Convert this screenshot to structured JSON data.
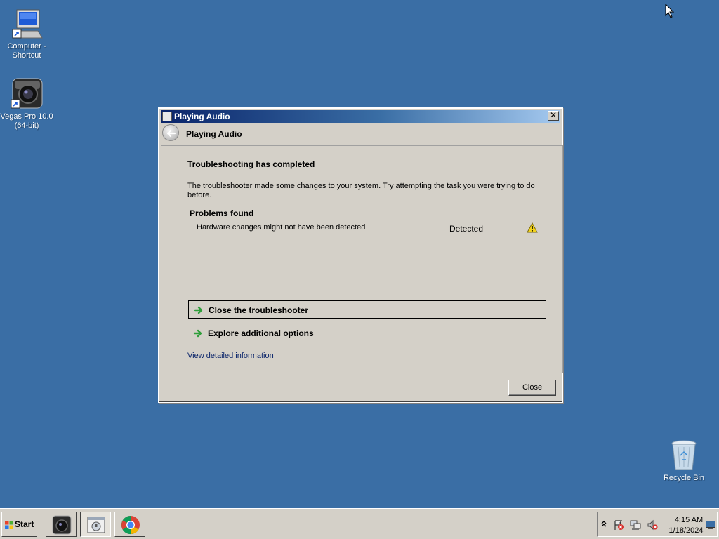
{
  "desktop": {
    "icons": [
      {
        "label_line1": "Computer -",
        "label_line2": "Shortcut",
        "icon": "computer-icon"
      },
      {
        "label_line1": "Vegas Pro 10.0",
        "label_line2": "(64-bit)",
        "icon": "vegas-pro-icon"
      },
      {
        "label_line1": "Recycle Bin",
        "icon": "recycle-bin-icon"
      }
    ]
  },
  "dialog": {
    "title": "Playing Audio",
    "nav_title": "Playing Audio",
    "heading": "Troubleshooting has completed",
    "description": "The troubleshooter made some changes to your system. Try attempting the task you were trying to do before.",
    "problems_title": "Problems found",
    "problems": [
      {
        "name": "Hardware changes might not have been detected",
        "status": "Detected",
        "icon": "warning-icon"
      }
    ],
    "options": [
      {
        "label": "Close the troubleshooter",
        "selected": true
      },
      {
        "label": "Explore additional options",
        "selected": false
      }
    ],
    "detail_link": "View detailed information",
    "close_button": "Close",
    "close_glyph": "✕"
  },
  "taskbar": {
    "start_label": "Start",
    "tasks": [
      "vegas-pro-icon",
      "troubleshooter-icon",
      "chrome-icon"
    ],
    "clock_time": "4:15 AM",
    "clock_date": "1/18/2024",
    "tray_icons": [
      "chevron-up-icon",
      "action-center-icon",
      "network-icon",
      "volume-muted-icon",
      "show-desktop-icon"
    ]
  },
  "colors": {
    "desktop": "#3a6ea5",
    "dialog_face": "#d4d0c8",
    "title_gradient_start": "#0a246a",
    "link": "#0a246a",
    "arrow_green": "#2e9e3a",
    "warning_yellow": "#f2d21b"
  }
}
